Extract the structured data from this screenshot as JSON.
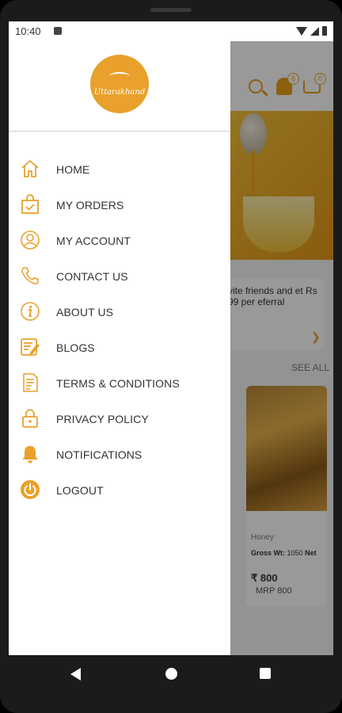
{
  "status_bar": {
    "time": "10:40"
  },
  "background_app": {
    "bell_badge": "6",
    "cart_badge": "0",
    "invite_text": "vite friends and et Rs 99 per eferral",
    "see_all": "SEE ALL",
    "product": {
      "category": "Honey",
      "gross_weight_label": "Gross Wt:",
      "gross_weight_value": "1050",
      "net_label": "Net",
      "price": "₹ 800",
      "mrp": "MRP  800"
    }
  },
  "drawer": {
    "logo_text": "Uttarakhand",
    "menu": [
      {
        "label": "HOME",
        "icon": "home-icon"
      },
      {
        "label": "MY ORDERS",
        "icon": "shopping-bag-icon"
      },
      {
        "label": "MY ACCOUNT",
        "icon": "user-circle-icon"
      },
      {
        "label": "CONTACT US",
        "icon": "phone-icon"
      },
      {
        "label": "ABOUT US",
        "icon": "info-icon"
      },
      {
        "label": "BLOGS",
        "icon": "blog-icon"
      },
      {
        "label": "TERMS & CONDITIONS",
        "icon": "document-icon"
      },
      {
        "label": "PRIVACY POLICY",
        "icon": "lock-icon"
      },
      {
        "label": "NOTIFICATIONS",
        "icon": "bell-icon"
      },
      {
        "label": "LOGOUT",
        "icon": "power-icon"
      }
    ]
  },
  "colors": {
    "accent": "#e9a12b",
    "text": "#333333",
    "scrim": "rgba(0,0,0,0.40)"
  }
}
